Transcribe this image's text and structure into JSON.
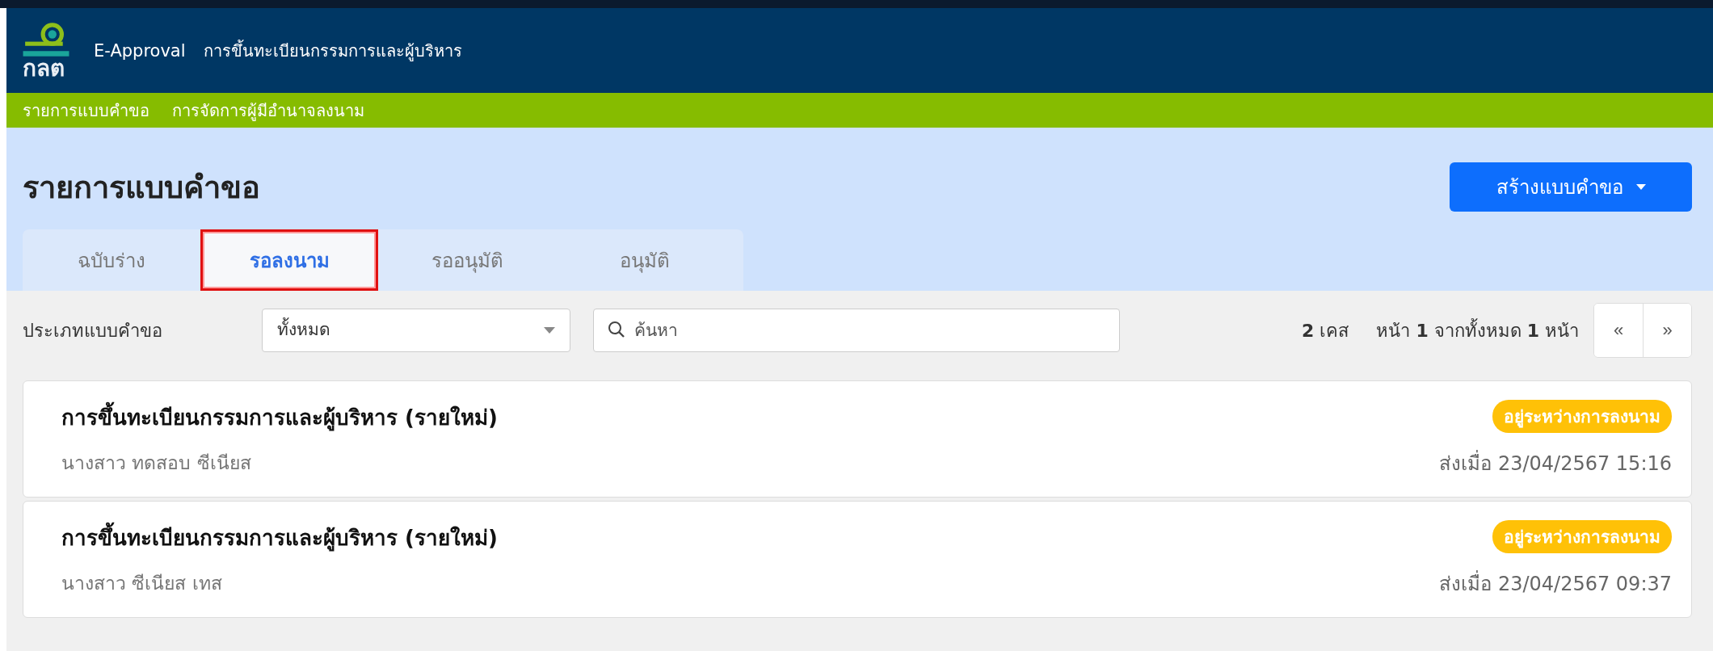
{
  "header": {
    "logo_text": "กลต",
    "app_name": "E-Approval",
    "module": "การขึ้นทะเบียนกรรมการและผู้บริหาร"
  },
  "nav": [
    "รายการแบบคำขอ",
    "การจัดการผู้มีอำนาจลงนาม"
  ],
  "page": {
    "title": "รายการแบบคำขอ",
    "create_button": "สร้างแบบคำขอ"
  },
  "tabs": [
    {
      "label": "ฉบับร่าง",
      "selected": false
    },
    {
      "label": "รอลงนาม",
      "selected": true
    },
    {
      "label": "รออนุมัติ",
      "selected": false
    },
    {
      "label": "อนุมัติ",
      "selected": false
    }
  ],
  "filter": {
    "label": "ประเภทแบบคำขอ",
    "type_value": "ทั้งหมด",
    "search_placeholder": "ค้นหา"
  },
  "pagination": {
    "count": "**2** เคส",
    "pages": "หน้า **1** จากทั้งหมด **1** หน้า",
    "prev": "«",
    "next": "»"
  },
  "requests": [
    {
      "title": "การขึ้นทะเบียนกรรมการและผู้บริหาร (รายใหม่)",
      "person": "นางสาว ทดสอบ ซีเนียส",
      "status": "อยู่ระหว่างการลงนาม",
      "color": "#ffc107",
      "sent": "ส่งเมื่อ 23/04/2567 15:16"
    },
    {
      "title": "การขึ้นทะเบียนกรรมการและผู้บริหาร (รายใหม่)",
      "person": "นางสาว ซีเนียส เทส",
      "status": "อยู่ระหว่างการลงนาม",
      "color": "#ffc107",
      "sent": "ส่งเมื่อ 23/04/2567 09:37"
    }
  ]
}
